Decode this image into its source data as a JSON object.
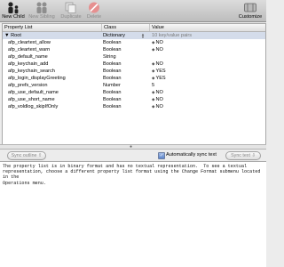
{
  "toolbar": {
    "new_child": "New Child",
    "new_sibling": "New Sibling",
    "duplicate": "Duplicate",
    "delete": "Delete",
    "customize": "Customize"
  },
  "table": {
    "headers": [
      "Property List",
      "Class",
      "Value"
    ],
    "root": {
      "key": "Root",
      "class": "Dictionary",
      "value": "10 key/value pairs"
    },
    "rows": [
      {
        "key": "afp_cleartext_allow",
        "class": "Boolean",
        "value": "NO"
      },
      {
        "key": "afp_cleartext_warn",
        "class": "Boolean",
        "value": "NO"
      },
      {
        "key": "afp_default_name",
        "class": "String",
        "value": ""
      },
      {
        "key": "afp_keychain_add",
        "class": "Boolean",
        "value": "NO"
      },
      {
        "key": "afp_keychain_search",
        "class": "Boolean",
        "value": "YES"
      },
      {
        "key": "afp_login_displayGreeting",
        "class": "Boolean",
        "value": "YES"
      },
      {
        "key": "afp_prefs_version",
        "class": "Number",
        "value": "5"
      },
      {
        "key": "afp_use_default_name",
        "class": "Boolean",
        "value": "NO"
      },
      {
        "key": "afp_use_short_name",
        "class": "Boolean",
        "value": "NO"
      },
      {
        "key": "afp_voldlog_skipIfOnly",
        "class": "Boolean",
        "value": "NO"
      }
    ]
  },
  "sync": {
    "outline_button": "Sync outline ⇧",
    "auto_sync_label": "Automatically sync text",
    "auto_sync_checked": true,
    "text_button": "Sync text ⇩"
  },
  "text_view": {
    "content": "The property list is in binary format and has no textual representation.  To see a textual\nrepresentation, choose a different property list format using the Change Format submenu located in the\nOperations menu."
  }
}
